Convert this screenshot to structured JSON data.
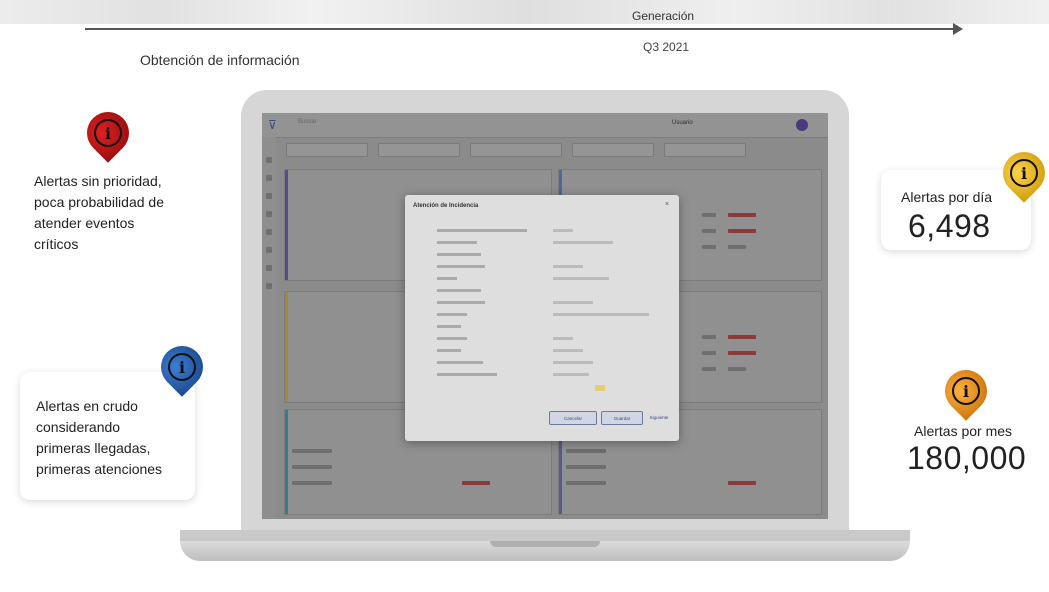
{
  "timeline": {
    "generacion": "Generación",
    "period": "Q3 2021",
    "obtencion": "Obtención de información"
  },
  "notes": {
    "sin_prioridad": [
      "Alertas sin prioridad,",
      "poca probabilidad de",
      "atender eventos",
      "críticos"
    ],
    "en_crudo": [
      "Alertas en crudo",
      "considerando",
      "primeras llegadas,",
      "primeras atenciones"
    ]
  },
  "stats": {
    "por_dia_label": "Alertas por día",
    "por_dia_value": "6,498",
    "por_mes_label": "Alertas por mes",
    "por_mes_value": "180,000"
  },
  "icons": {
    "red": "info-drop-red-icon",
    "blue": "info-drop-blue-icon",
    "yellow": "info-drop-yellow-icon",
    "orange": "info-drop-orange-icon",
    "glyph": "i"
  },
  "colors": {
    "red": "#b01515",
    "blue": "#2a63b0",
    "yellow": "#f2b90f",
    "orange": "#e98f10"
  },
  "app": {
    "logo_glyph": "⊽",
    "search": "Buscar",
    "user": "Usuario",
    "modal": {
      "title": "Atención de Incidencia",
      "close": "×",
      "cancel": "Cancelar",
      "save": "Guardar",
      "next": "Siguiente"
    }
  }
}
